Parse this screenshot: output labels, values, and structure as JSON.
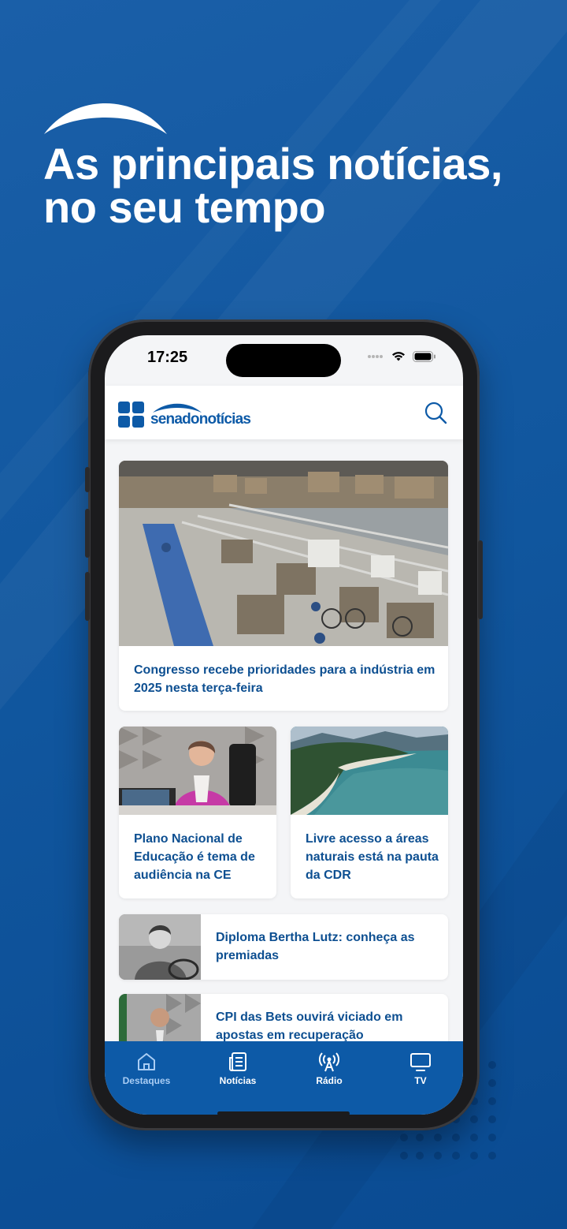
{
  "promo": {
    "headline_line1": "As principais notícias,",
    "headline_line2": "no seu tempo"
  },
  "status_bar": {
    "time": "17:25"
  },
  "app": {
    "logo_text": "senadonotícias",
    "search_icon": "search-icon"
  },
  "articles": {
    "featured": {
      "title": "Congresso recebe prioridades para a indústria em 2025 nesta terça-feira"
    },
    "left": {
      "title": "Plano Nacional de Educação é tema de audiência na CE"
    },
    "right": {
      "title": "Livre acesso a áreas naturais está na pauta da CDR"
    },
    "list": [
      {
        "title": "Diploma Bertha Lutz: conheça as premiadas"
      },
      {
        "title": "CPI das Bets ouvirá viciado em apostas em recuperação"
      }
    ]
  },
  "tabs": [
    {
      "label": "Destaques",
      "icon": "home-icon",
      "active": true
    },
    {
      "label": "Notícias",
      "icon": "newspaper-icon",
      "active": false
    },
    {
      "label": "Rádio",
      "icon": "radio-antenna-icon",
      "active": false
    },
    {
      "label": "TV",
      "icon": "tv-icon",
      "active": false
    }
  ],
  "colors": {
    "background": "#11579f",
    "brand": "#0d5aa7",
    "title_text": "#0d4f91",
    "active_tab": "#a9cdf4"
  }
}
